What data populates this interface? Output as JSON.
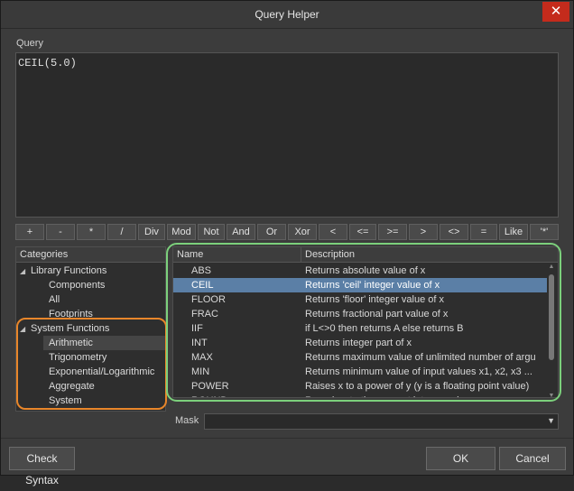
{
  "window": {
    "title": "Query Helper",
    "close_glyph": "✕"
  },
  "query": {
    "label": "Query",
    "value": "CEIL(5.0)"
  },
  "operators": [
    "+",
    "-",
    "*",
    "/",
    "Div",
    "Mod",
    "Not",
    "And",
    "Or",
    "Xor",
    "<",
    "<=",
    ">=",
    ">",
    "<>",
    "=",
    "Like",
    "'*'"
  ],
  "categories": {
    "header": "Categories",
    "items": [
      {
        "label": "Library Functions",
        "expanded": true
      },
      {
        "label": "Components"
      },
      {
        "label": "All"
      },
      {
        "label": "Footprints"
      },
      {
        "label": "System Functions",
        "expanded": true
      },
      {
        "label": "Arithmetic",
        "selected": true
      },
      {
        "label": "Trigonometry"
      },
      {
        "label": "Exponential/Logarithmic"
      },
      {
        "label": "Aggregate"
      },
      {
        "label": "System"
      }
    ]
  },
  "functions": {
    "columns": {
      "name": "Name",
      "description": "Description"
    },
    "rows": [
      {
        "name": "ABS",
        "description": "Returns absolute value of x"
      },
      {
        "name": "CEIL",
        "description": "Returns 'ceil' integer value of x",
        "selected": true
      },
      {
        "name": "FLOOR",
        "description": "Returns 'floor' integer value of x"
      },
      {
        "name": "FRAC",
        "description": "Returns fractional part value of x"
      },
      {
        "name": "IIF",
        "description": "if L<>0 then returns A else returns B"
      },
      {
        "name": "INT",
        "description": "Returns integer part of x"
      },
      {
        "name": "MAX",
        "description": "Returns maximum value of unlimited number of argu"
      },
      {
        "name": "MIN",
        "description": "Returns minimum value of input values x1, x2, x3 ..."
      },
      {
        "name": "POWER",
        "description": "Raises x to a power of y (y is a floating point value)"
      },
      {
        "name": "ROUND",
        "description": "Rounds x to the nearest integer value"
      }
    ]
  },
  "mask": {
    "label": "Mask",
    "value": ""
  },
  "buttons": {
    "check_syntax": "Check Syntax",
    "ok": "OK",
    "cancel": "Cancel"
  },
  "colors": {
    "selection": "#5b7fa6",
    "highlight_categories": "#e8862a",
    "highlight_functions": "#7cd07c",
    "close_button": "#c42b1c"
  }
}
